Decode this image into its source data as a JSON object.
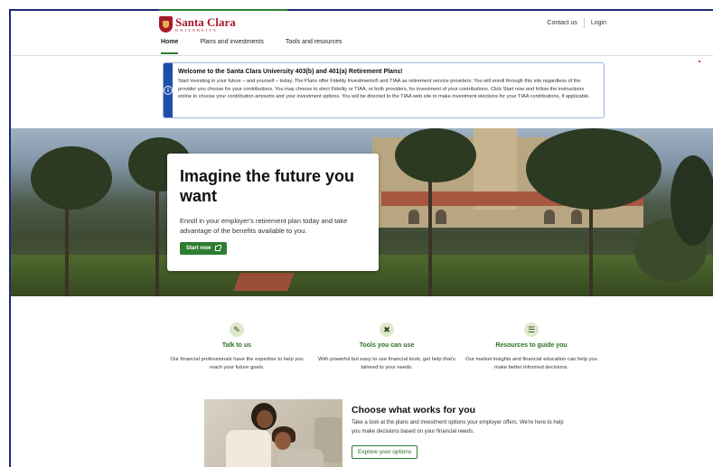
{
  "logo": {
    "name": "Santa Clara",
    "subtitle": "UNIVERSITY"
  },
  "utility": {
    "contact": "Contact us",
    "login": "Login"
  },
  "nav": {
    "items": [
      "Home",
      "Plans and investments",
      "Tools and resources"
    ],
    "active": "Home"
  },
  "alert": {
    "title": "Welcome to the Santa Clara University 403(b) and 401(a) Retirement Plans!",
    "text": "Start investing in your future – and yourself – today. The Plans offer Fidelity Investments® and TIAA as retirement service providers. You will enroll through this site regardless of the provider you choose for your contributions. You may choose to elect Fidelity or TIAA, or both providers, for investment of your contributions. Click Start now and follow the instructions online to choose your contribution amounts and your investment options. You will be directed to the TIAA web site to make investment elections for your TIAA contributions, if applicable."
  },
  "hero": {
    "title": "Imagine the future you want",
    "text": "Enroll in your employer's retirement plan today and take advantage of the benefits available to you.",
    "button": "Start now"
  },
  "features": [
    {
      "icon": "chat-icon",
      "title": "Talk to us",
      "text": "Our financial professionals have the expertise to help you reach your future goals."
    },
    {
      "icon": "tools-icon",
      "title": "Tools you can use",
      "text": "With powerful but easy to use financial tools, get help that's tailored to your needs."
    },
    {
      "icon": "map-icon",
      "title": "Resources to guide you",
      "text": "Our market insights and financial education can help you make better informed decisions."
    }
  ],
  "choose": {
    "title": "Choose what works for you",
    "text": "Take a look at the plans and investment options your employer offers. We're here to help you make decisions based on your financial needs.",
    "button": "Explore your options"
  },
  "colors": {
    "brand_red": "#a6192e",
    "accent_green": "#2e7d32",
    "info_blue": "#1e4fa8"
  }
}
